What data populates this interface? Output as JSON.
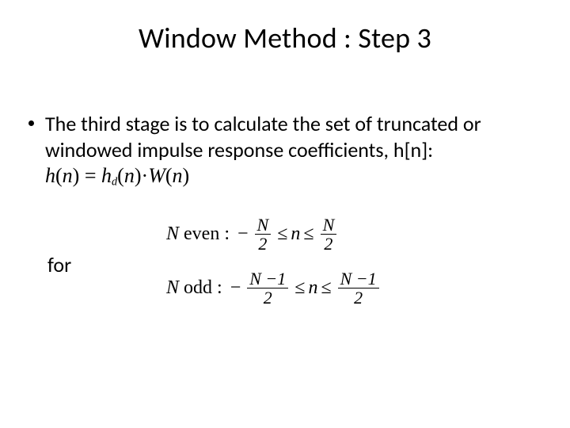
{
  "title": "Window Method : Step 3",
  "bullet_text": "The  third stage is to calculate the set of truncated or windowed impulse response coefficients, h[n]:",
  "equation": {
    "lhs_h": "h",
    "lhs_n": "n",
    "eq": "=",
    "rhs_hd": "h",
    "rhs_d_sub": "d",
    "rhs_n1": "n",
    "dot": "·",
    "rhs_W": "W",
    "rhs_n2": "n"
  },
  "for_label": "for",
  "cond_even": {
    "label_N": "N",
    "label_word": " even :",
    "neg": "−",
    "num1": "N",
    "den1": "2",
    "le1": "≤",
    "n": "n",
    "le2": "≤",
    "num2": "N",
    "den2": "2"
  },
  "cond_odd": {
    "label_N": "N",
    "label_word": " odd :",
    "neg": "−",
    "num1": "N −1",
    "den1": "2",
    "le1": "≤",
    "n": "n",
    "le2": "≤",
    "num2": "N −1",
    "den2": "2"
  }
}
